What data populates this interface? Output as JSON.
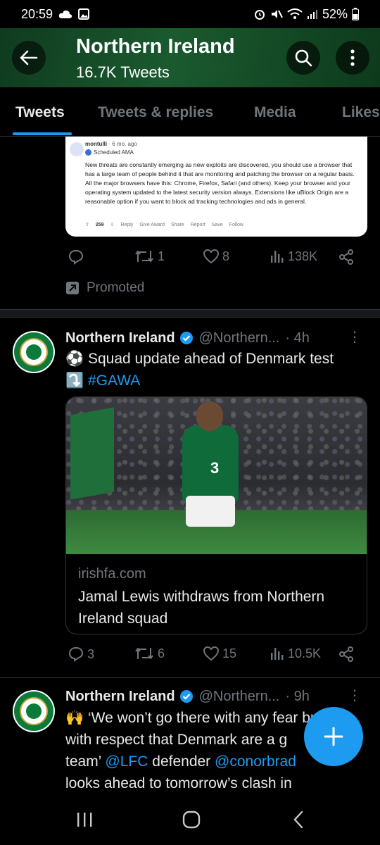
{
  "status_bar": {
    "time": "20:59",
    "battery": "52%",
    "left_icons": [
      "cloud-icon",
      "gallery-icon"
    ],
    "right_icons": [
      "alarm-icon",
      "mute-icon",
      "wifi-icon",
      "signal-icon",
      "battery-icon"
    ]
  },
  "header": {
    "title": "Northern Ireland",
    "subtitle": "16.7K Tweets",
    "back_icon": "back-arrow-icon",
    "search_icon": "search-icon",
    "more_icon": "more-vertical-icon",
    "accent_color": "#1b5a2f"
  },
  "tabs": [
    {
      "label": "Tweets",
      "active": true
    },
    {
      "label": "Tweets & replies",
      "active": false
    },
    {
      "label": "Media",
      "active": false
    },
    {
      "label": "Likes",
      "active": false
    }
  ],
  "promoted_tweet": {
    "embed": {
      "username": "montulli",
      "age": "· 6 mo. ago",
      "tag": "Scheduled AMA",
      "body": "New threats are constantly emerging as new exploits are discovered, you should use a browser that has a large team of people behind it that are monitoring and patching the browser on a regular basis. All the major browsers have this: Chrome, Firefox, Safari (and others). Keep your browser and your operating system updated to the latest security version always. Extensions like uBlock Origin are a reasonable option if you want to block ad tracking technologies and ads in general.",
      "votes": "259",
      "actions": [
        "Reply",
        "Give Award",
        "Share",
        "Report",
        "Save",
        "Follow"
      ]
    },
    "stats": {
      "replies": "",
      "retweets": "1",
      "likes": "8",
      "views": "138K"
    },
    "promoted_label": "Promoted"
  },
  "tweets": [
    {
      "name": "Northern Ireland",
      "handle": "@Northern...",
      "time": "· 4h",
      "text_prefix": "⚽ Squad update ahead of Denmark test",
      "text_arrow": "⤵️",
      "hashtag": "#GAWA",
      "card": {
        "domain": "irishfa.com",
        "title": "Jamal Lewis withdraws from Northern Ireland squad",
        "shirt_number": "3"
      },
      "stats": {
        "replies": "3",
        "retweets": "6",
        "likes": "15",
        "views": "10.5K"
      }
    },
    {
      "name": "Northern Ireland",
      "handle": "@Northern...",
      "time": "· 9h",
      "line1_emoji": "🙌",
      "line1": "‘We won’t go there with any fear but",
      "line2": "with respect that Denmark are a g",
      "line3_text": "team’",
      "line3_mention1": "@LFC",
      "line3_mid": "defender",
      "line3_mention2": "@conorbrad",
      "line4": "looks ahead to tomorrow’s clash in"
    }
  ],
  "fab": {
    "icon": "plus-icon",
    "color": "#1d9bf0"
  },
  "navbar": {
    "icons": [
      "recent-apps-icon",
      "home-icon",
      "back-icon"
    ]
  }
}
